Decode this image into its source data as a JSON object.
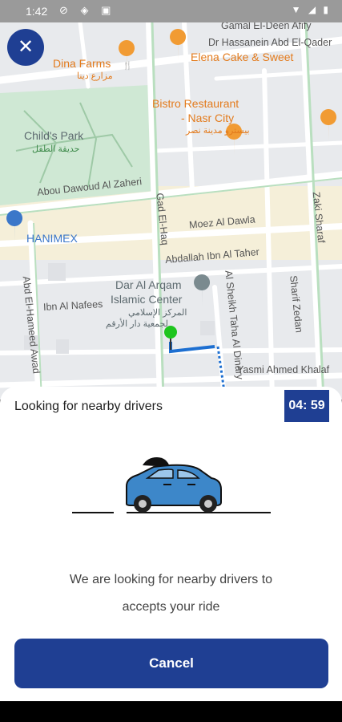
{
  "status_bar": {
    "time": "1:42"
  },
  "map": {
    "streets": [
      "Gamal El-Deen Afify",
      "Dr Hassanein Abd El-Qader",
      "Abou Dawoud Al Zaheri",
      "Gad El-Haq",
      "Moez Al Dawla",
      "Abdallah Ibn Al Taher",
      "Zaki Sharaf",
      "Ibn Al Nafees",
      "Abd El-Hameed Awad",
      "Al Sheikh Taha Al Dinary",
      "Sharif Zedan",
      "Yasmi Ahmed Khalaf"
    ],
    "pois": {
      "dina_farms": {
        "name": "Dina Farms",
        "arabic": "مزارع دينا"
      },
      "elena": {
        "name": "Elena Cake & Sweet"
      },
      "bistro": {
        "line1": "Bistro Restaurant",
        "line2": "- Nasr City",
        "arabic": "بيسترو مدينة نصر"
      },
      "childs_park": {
        "name": "Child's Park",
        "arabic": "حديقة الطفل"
      },
      "hanimex": {
        "name": "HANIMEX"
      },
      "mosque": {
        "line1": "Dar Al Arqam",
        "line2": "Islamic Center",
        "arabic1": "المركز الإسلامي",
        "arabic2": "لجمعية دار الأرقم"
      }
    }
  },
  "sheet": {
    "title": "Looking for nearby drivers",
    "timer": "04: 59",
    "message_line1": "We are looking for nearby drivers to",
    "message_line2": "accepts your ride",
    "cancel_label": "Cancel"
  },
  "colors": {
    "primary": "#1f3f93",
    "car_body": "#3d87c9",
    "marker": "#1ec51e",
    "route": "#1d6fd1"
  },
  "icons": [
    "close-icon",
    "restaurant-pin-icon",
    "shopping-pin-icon",
    "mosque-pin-icon",
    "destination-marker-icon",
    "car-illustration"
  ]
}
